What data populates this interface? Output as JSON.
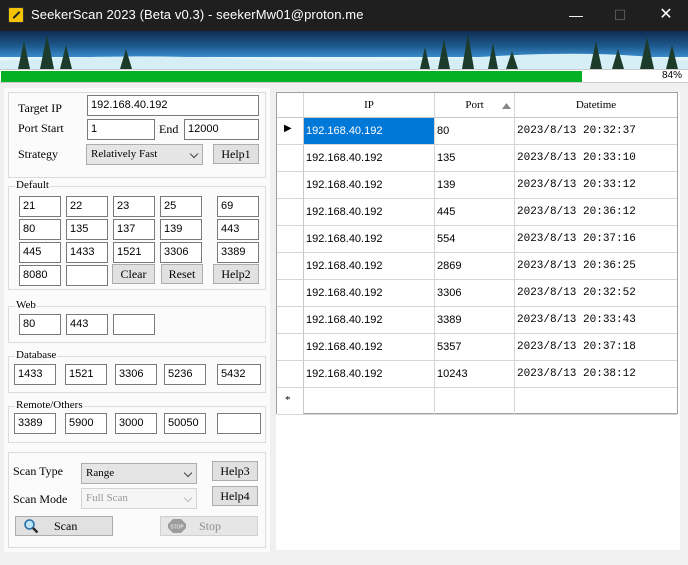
{
  "window": {
    "title": "SeekerScan 2023 (Beta v0.3) - seekerMw01@proton.me",
    "controls": {
      "minimize": "—",
      "maximize": "☐",
      "close": "✕"
    }
  },
  "progress": {
    "value": 0.84,
    "label": "84%"
  },
  "target": {
    "ip_label": "Target IP",
    "ip_value": "192.168.40.192",
    "port_start_label": "Port Start",
    "port_start_value": "1",
    "end_label": "End",
    "end_value": "12000",
    "strategy_label": "Strategy",
    "strategy_value": "Relatively Fast",
    "help1": "Help1"
  },
  "default_ports": {
    "label": "Default",
    "values": [
      "21",
      "22",
      "23",
      "25",
      "69",
      "80",
      "135",
      "137",
      "139",
      "443",
      "445",
      "1433",
      "1521",
      "3306",
      "3389",
      "8080",
      ""
    ],
    "clear": "Clear",
    "reset": "Reset",
    "help2": "Help2"
  },
  "web_ports": {
    "label": "Web",
    "values": [
      "80",
      "443",
      ""
    ]
  },
  "database_ports": {
    "label": "Database",
    "values": [
      "1433",
      "1521",
      "3306",
      "5236",
      "5432"
    ]
  },
  "remote_ports": {
    "label": "Remote/Others",
    "values": [
      "3389",
      "5900",
      "3000",
      "50050",
      ""
    ]
  },
  "scan": {
    "type_label": "Scan Type",
    "type_value": "Range",
    "help3": "Help3",
    "mode_label": "Scan Mode",
    "mode_value": "Full Scan",
    "help4": "Help4",
    "scan_button": "Scan",
    "stop_button": "Stop",
    "stop_icon_text": "STOP"
  },
  "results": {
    "columns": [
      "IP",
      "Port",
      "Datetime"
    ],
    "rows": [
      {
        "ip": "192.168.40.192",
        "port": "80",
        "datetime": "2023/8/13 20:32:37"
      },
      {
        "ip": "192.168.40.192",
        "port": "135",
        "datetime": "2023/8/13 20:33:10"
      },
      {
        "ip": "192.168.40.192",
        "port": "139",
        "datetime": "2023/8/13 20:33:12"
      },
      {
        "ip": "192.168.40.192",
        "port": "445",
        "datetime": "2023/8/13 20:36:12"
      },
      {
        "ip": "192.168.40.192",
        "port": "554",
        "datetime": "2023/8/13 20:37:16"
      },
      {
        "ip": "192.168.40.192",
        "port": "2869",
        "datetime": "2023/8/13 20:36:25"
      },
      {
        "ip": "192.168.40.192",
        "port": "3306",
        "datetime": "2023/8/13 20:32:52"
      },
      {
        "ip": "192.168.40.192",
        "port": "3389",
        "datetime": "2023/8/13 20:33:43"
      },
      {
        "ip": "192.168.40.192",
        "port": "5357",
        "datetime": "2023/8/13 20:37:18"
      },
      {
        "ip": "192.168.40.192",
        "port": "10243",
        "datetime": "2023/8/13 20:38:12"
      }
    ],
    "current_row_marker": "▶",
    "new_row_marker": "*"
  },
  "colors": {
    "progress": "#06b025",
    "selection": "#0078d7",
    "titlebar": "#1f1f1f"
  }
}
